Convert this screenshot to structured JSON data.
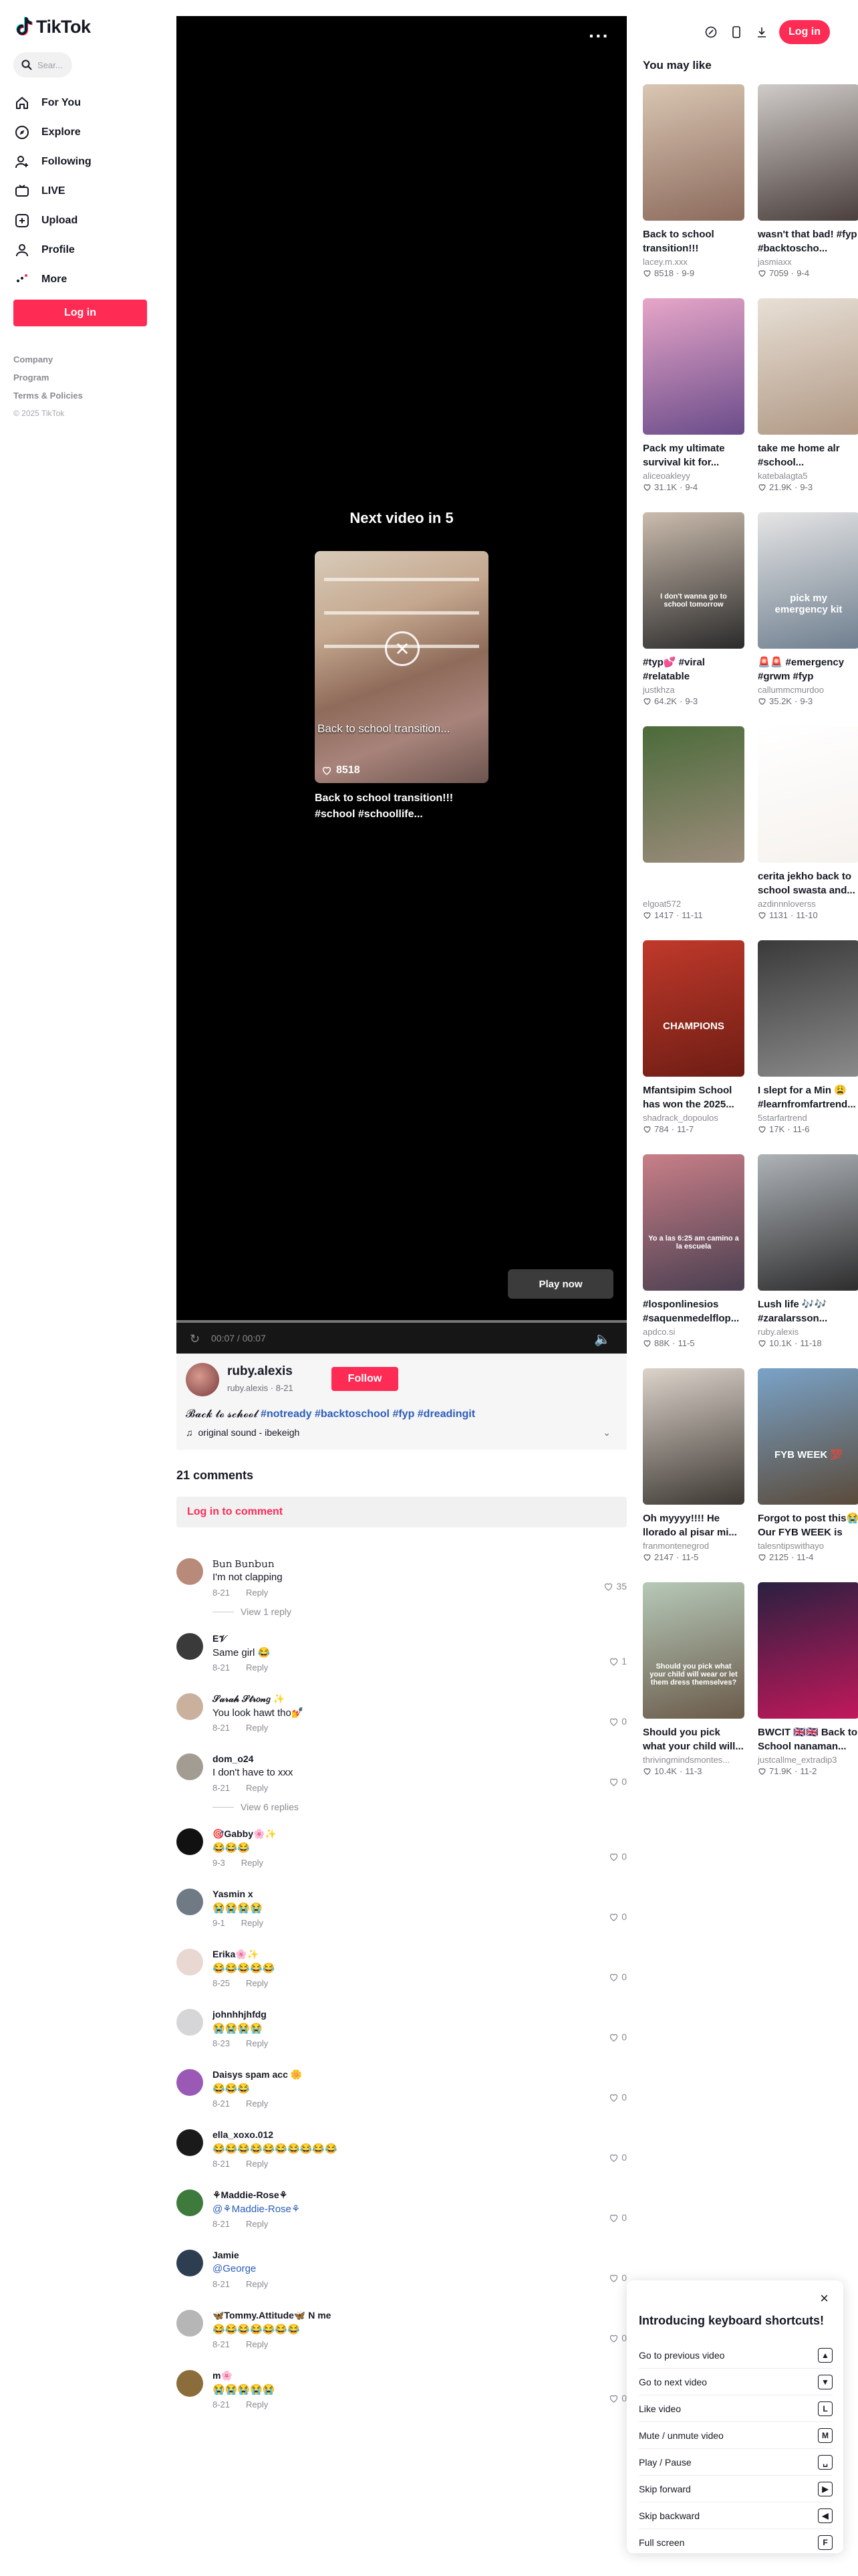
{
  "app": {
    "name": "TikTok",
    "brand_color": "#fe2c55"
  },
  "sidebar": {
    "search_placeholder": "Sear...",
    "items": [
      {
        "label": "For You",
        "icon": "home-icon"
      },
      {
        "label": "Explore",
        "icon": "compass-icon"
      },
      {
        "label": "Following",
        "icon": "user-plus-icon"
      },
      {
        "label": "LIVE",
        "icon": "live-icon"
      },
      {
        "label": "Upload",
        "icon": "upload-icon"
      },
      {
        "label": "Profile",
        "icon": "profile-icon"
      },
      {
        "label": "More",
        "icon": "more-icon"
      }
    ],
    "login_label": "Log in",
    "links": [
      "Company",
      "Program",
      "Terms & Policies"
    ],
    "copyright": "© 2025 TikTok"
  },
  "header": {
    "login_label": "Log in",
    "more_glyph": "···"
  },
  "player": {
    "next_label": "Next video in 5",
    "next_caption": "Back to school transition...",
    "next_likes": "8518",
    "next_title": "Back to school transition!!! #school #schoollife...",
    "play_now_label": "Play now",
    "time": "00:07 / 00:07"
  },
  "author": {
    "name": "ruby.alexis",
    "handle_date": "ruby.alexis · 8-21",
    "follow_label": "Follow",
    "desc_text": "𝓑𝓪𝓬𝓴 𝓽𝓸 𝓼𝓬𝓱𝓸𝓸𝓵 ",
    "desc_tags": "#notready #backtoschool #fyp #dreadingit",
    "sound": "original sound - ibekeigh"
  },
  "comments": {
    "count_label": "21 comments",
    "login_prompt": "Log in to comment",
    "items": [
      {
        "name": "𝙱𝚞𝚗 𝙱𝚞𝚗𝚋𝚞𝚗",
        "text": "I'm not clapping",
        "date": "8-21",
        "likes": "35",
        "color": "#b88a7a",
        "more": "View 1 reply"
      },
      {
        "name": "E𝒱",
        "text": "Same girl 😂",
        "date": "8-21",
        "likes": "1",
        "color": "#3a3a3a"
      },
      {
        "name": "𝒮𝒶𝓇𝒶𝒽 𝒮𝓉𝓇𝑜𝓃𝑔 ✨",
        "text": "You look hawt tho💅",
        "date": "8-21",
        "likes": "0",
        "color": "#c9b19e"
      },
      {
        "name": "dom_o24",
        "text": "I don't have to xxx",
        "date": "8-21",
        "likes": "0",
        "color": "#a39c93",
        "more": "View 6 replies"
      },
      {
        "name": "🎯Gabby🌸✨",
        "text": "😂😂😂",
        "date": "9-3",
        "likes": "0",
        "color": "#111111"
      },
      {
        "name": "Yasmin x",
        "text": "😭😭😭😭",
        "date": "9-1",
        "likes": "0",
        "color": "#6f7a85"
      },
      {
        "name": "Erika🌸✨",
        "text": "😂😂😂😂😂",
        "date": "8-25",
        "likes": "0",
        "color": "#e9d7d2"
      },
      {
        "name": "johnhhjhfdg",
        "text": "😭😭😭😭",
        "date": "8-23",
        "likes": "0",
        "color": "#d6d6d8"
      },
      {
        "name": "Daisys spam acc 🌼",
        "text": "😂😂😂",
        "date": "8-21",
        "likes": "0",
        "color": "#9b59b6"
      },
      {
        "name": "ella_xoxo.012",
        "text": "😂😂😂😂😂😂😂😂😂😂",
        "date": "8-21",
        "likes": "0",
        "color": "#1a1a1a"
      },
      {
        "name": "⚘Maddie-Rose⚘",
        "text": "@⚘Maddie-Rose⚘",
        "date": "8-21",
        "likes": "0",
        "color": "#3e7a3c",
        "mention": true
      },
      {
        "name": "Jamie",
        "text": "@George",
        "date": "8-21",
        "likes": "0",
        "color": "#2c3e50",
        "mention": true
      },
      {
        "name": "🦋Tommy.Attitude🦋 N me",
        "text": "😂😂😂😂😂😂😂",
        "date": "8-21",
        "likes": "0",
        "color": "#b6b6b6"
      },
      {
        "name": "m🌸",
        "text": "😭😭😭😭😭",
        "date": "8-21",
        "likes": "0",
        "color": "#8a6d3b"
      }
    ]
  },
  "recommended": {
    "title": "You may like",
    "items": [
      {
        "title": "Back to school transition!!! #schoo...",
        "author": "lacey.m.xxx",
        "likes": "8518",
        "date": "9-9",
        "c1": "#d9c6b3",
        "c2": "#8b6a5c"
      },
      {
        "title": "wasn't that bad! #fyp #backtoscho...",
        "author": "jasmiaxx",
        "likes": "7059",
        "date": "9-4",
        "c1": "#cfcbc8",
        "c2": "#4a3f3c"
      },
      {
        "title": "Pack my ultimate survival kit for...",
        "author": "aliceoakleyy",
        "likes": "31.1K",
        "date": "9-4",
        "c1": "#e7a6c8",
        "c2": "#6a4c8a"
      },
      {
        "title": "take me home alr #school...",
        "author": "katebalagta5",
        "likes": "21.9K",
        "date": "9-3",
        "c1": "#e8e0d6",
        "c2": "#b09884"
      },
      {
        "title": "#typ💕 #viral #relatable",
        "author": "justkhza",
        "likes": "64.2K",
        "date": "9-3",
        "c1": "#cbbcad",
        "c2": "#2b2b2b",
        "overlay": "I don't wanna go to school tomorrow"
      },
      {
        "title": "🚨🚨 #emergency #grwm #fyp",
        "author": "callummcmurdoo",
        "likes": "35.2K",
        "date": "9-3",
        "c1": "#e5e5e5",
        "c2": "#6f7f8f",
        "overlay": "pick my emergency kit"
      },
      {
        "title": "",
        "author": "elgoat572",
        "likes": "1417",
        "date": "11-11",
        "c1": "#4c6b3a",
        "c2": "#9c8c7c"
      },
      {
        "title": "cerita jekho back to school swasta and...",
        "author": "azdinnnloverss",
        "likes": "1131",
        "date": "11-10",
        "c1": "#ffffff",
        "c2": "#f6f2ee"
      },
      {
        "title": "Mfantsipim School has won the 2025...",
        "author": "shadrack_dopoulos",
        "likes": "784",
        "date": "11-7",
        "c1": "#c0392b",
        "c2": "#6e1d14",
        "overlay": "CHAMPIONS"
      },
      {
        "title": "I slept for a Min 😩 #learnfromfartrend...",
        "author": "5starfartrend",
        "likes": "17K",
        "date": "11-6",
        "c1": "#3a3a3a",
        "c2": "#8a8a8a"
      },
      {
        "title": "#losponlinesios #saquenmedelflop...",
        "author": "apdco.si",
        "likes": "88K",
        "date": "11-5",
        "c1": "#c97f88",
        "c2": "#4a3f50",
        "overlay": "Yo a las 6:25 am camino a la escuela"
      },
      {
        "title": "Lush life 🎶🎶 #zaralarsson...",
        "author": "ruby.alexis",
        "likes": "10.1K",
        "date": "11-18",
        "c1": "#aeb3b8",
        "c2": "#2d2d2d"
      },
      {
        "title": "Oh myyyy!!!! He llorado al pisar mi...",
        "author": "franmontenegrod",
        "likes": "2147",
        "date": "11-5",
        "c1": "#dcd3ca",
        "c2": "#3d3833"
      },
      {
        "title": "Forgot to post this😭 Our FYB WEEK is lit...",
        "author": "talesntipswithayo",
        "likes": "2125",
        "date": "11-4",
        "c1": "#7aa3c8",
        "c2": "#5a4a3a",
        "overlay": "FYB WEEK 💯"
      },
      {
        "title": "Should you pick what your child will...",
        "author": "thrivingmindsmontes...",
        "likes": "10.4K",
        "date": "11-3",
        "c1": "#b6c9b8",
        "c2": "#6a5a4a",
        "overlay": "Should you pick what your child will wear or let them dress themselves?"
      },
      {
        "title": "BWCIT 🇬🇧🇬🇧 Back to School nanaman...",
        "author": "justcallme_extradip3",
        "likes": "71.9K",
        "date": "11-2",
        "c1": "#2a2040",
        "c2": "#c2185b"
      }
    ]
  },
  "shortcuts": {
    "title": "Introducing keyboard shortcuts!",
    "close_glyph": "×",
    "items": [
      {
        "label": "Go to previous video",
        "key": "▲"
      },
      {
        "label": "Go to next video",
        "key": "▼"
      },
      {
        "label": "Like video",
        "key": "L"
      },
      {
        "label": "Mute / unmute video",
        "key": "M"
      },
      {
        "label": "Play / Pause",
        "key": "␣"
      },
      {
        "label": "Skip forward",
        "key": "▶"
      },
      {
        "label": "Skip backward",
        "key": "◀"
      },
      {
        "label": "Full screen",
        "key": "F"
      }
    ]
  }
}
